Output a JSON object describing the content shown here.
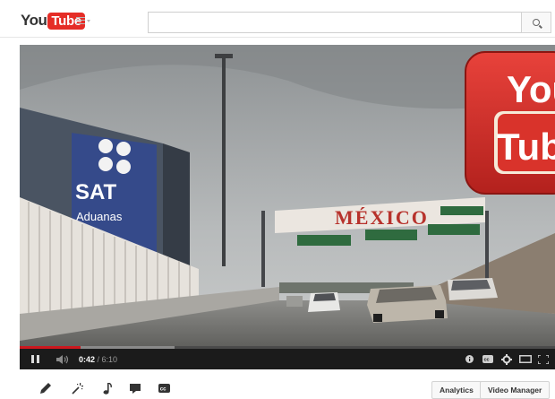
{
  "masthead": {
    "logo_you": "You",
    "logo_tube": "Tube",
    "search_placeholder": "",
    "brand_color": "#e52d27"
  },
  "video": {
    "scene_signs": {
      "sat": "SAT",
      "aduanas": "Aduanas",
      "mexico": "MÉXICO"
    },
    "watermark": {
      "you": "You",
      "tube": "Tub"
    }
  },
  "player": {
    "current_time": "0:42",
    "separator": " / ",
    "duration": "6:10",
    "played_fraction": 0.113,
    "loaded_fraction": 0.29,
    "progress_color": "#cc181e"
  },
  "edit_bar": {
    "analytics_label": "Analytics",
    "video_manager_label": "Video Manager",
    "tools": [
      "pencil-icon",
      "magic-wand-icon",
      "music-note-icon",
      "speech-bubble-icon",
      "cc-icon"
    ]
  }
}
